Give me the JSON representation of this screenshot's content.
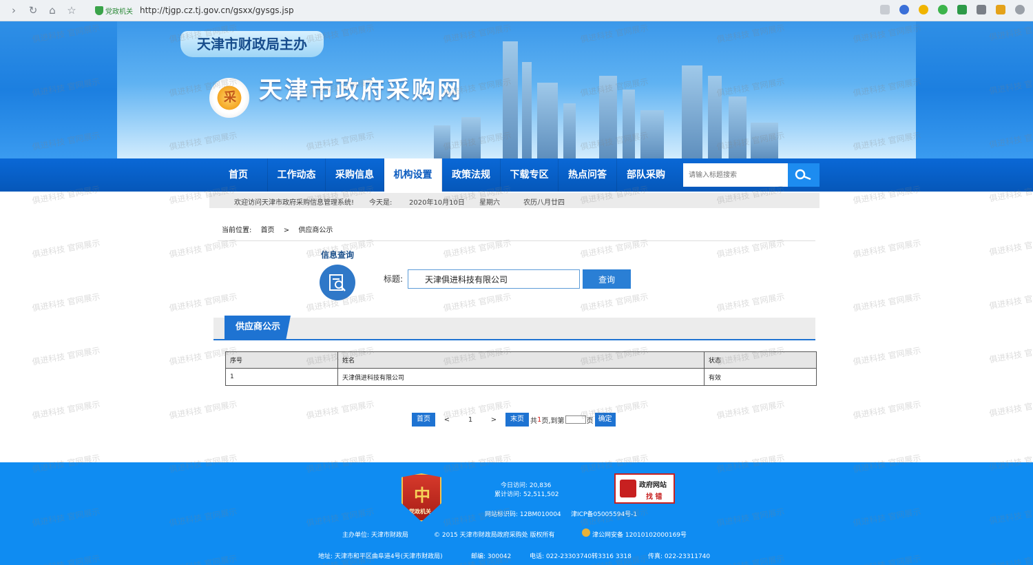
{
  "browser": {
    "badge": "党政机关",
    "url": "http://tjgp.cz.tj.gov.cn/gsxx/gysgs.jsp"
  },
  "banner": {
    "sponsor": "天津市财政局主办",
    "site_name": "天津市政府采购网",
    "logo_char": "采"
  },
  "nav": {
    "items": [
      "首页",
      "工作动态",
      "采购信息",
      "机构设置",
      "政策法规",
      "下载专区",
      "热点问答",
      "部队采购"
    ],
    "active_index": 3,
    "search_placeholder": "请输入标题搜索"
  },
  "welcome": {
    "greeting": "欢迎访问天津市政府采购信息管理系统!",
    "today_label": "今天是:",
    "date": "2020年10月10日",
    "weekday": "星期六",
    "lunar": "农历八月廿四"
  },
  "breadcrumb": {
    "label": "当前位置:",
    "home": "首页",
    "sep": ">",
    "current": "供应商公示"
  },
  "query": {
    "title": "信息查询",
    "label": "标题:",
    "value": "天津俱进科技有限公司",
    "button": "查询"
  },
  "section": {
    "tab": "供应商公示"
  },
  "table": {
    "headers": [
      "序号",
      "姓名",
      "状态"
    ],
    "rows": [
      [
        "1",
        "天津俱进科技有限公司",
        "有效"
      ]
    ]
  },
  "pager": {
    "first": "首页",
    "prev": "<",
    "page": "1",
    "next": ">",
    "last": "末页",
    "total_prefix": "共",
    "total": "1",
    "total_suffix": "页,到第",
    "page_suffix": "页",
    "confirm": "确定"
  },
  "footer": {
    "party_badge": "党政机关",
    "today_visits": "今日访问: 20,836",
    "total_visits": "累计访问: 52,511,502",
    "gov_badge_line1": "政府网站",
    "gov_badge_line2": "找 错",
    "site_id": "网站标识码: 12BM010004",
    "icp": "津ICP备05005594号-1",
    "host": "主办单位: 天津市财政局",
    "copyright": "© 2015 天津市财政局政府采购处 版权所有",
    "police": "津公网安备 12010102000169号",
    "address": "地址: 天津市和平区曲阜道4号(天津市财政局)",
    "postcode": "邮编: 300042",
    "phone": "电话: 022-23303740转3316 3318",
    "fax": "传真: 022-23311740"
  },
  "watermark": "俱进科技 官网展示",
  "colors": {
    "nav_blue": "#0a68d6",
    "footer_blue": "#0f8cf2",
    "accent_blue": "#1e73d2"
  }
}
